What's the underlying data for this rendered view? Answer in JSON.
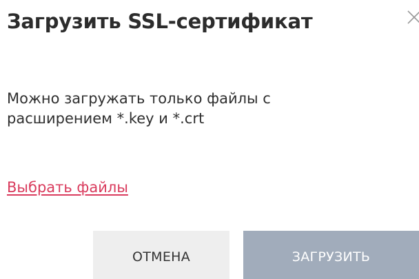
{
  "dialog": {
    "title": "Загрузить SSL-сертификат",
    "message": "Можно загружать только файлы с расширением *.key и *.crt",
    "select_files_label": "Выбрать файлы",
    "cancel_label": "ОТМЕНА",
    "upload_label": "ЗАГРУЗИТЬ",
    "close_icon": "close-icon"
  },
  "colors": {
    "link": "#d93a5c",
    "cancel_bg": "#eeeeee",
    "upload_bg_disabled": "#a1acbb",
    "title": "#2c2c2c"
  }
}
